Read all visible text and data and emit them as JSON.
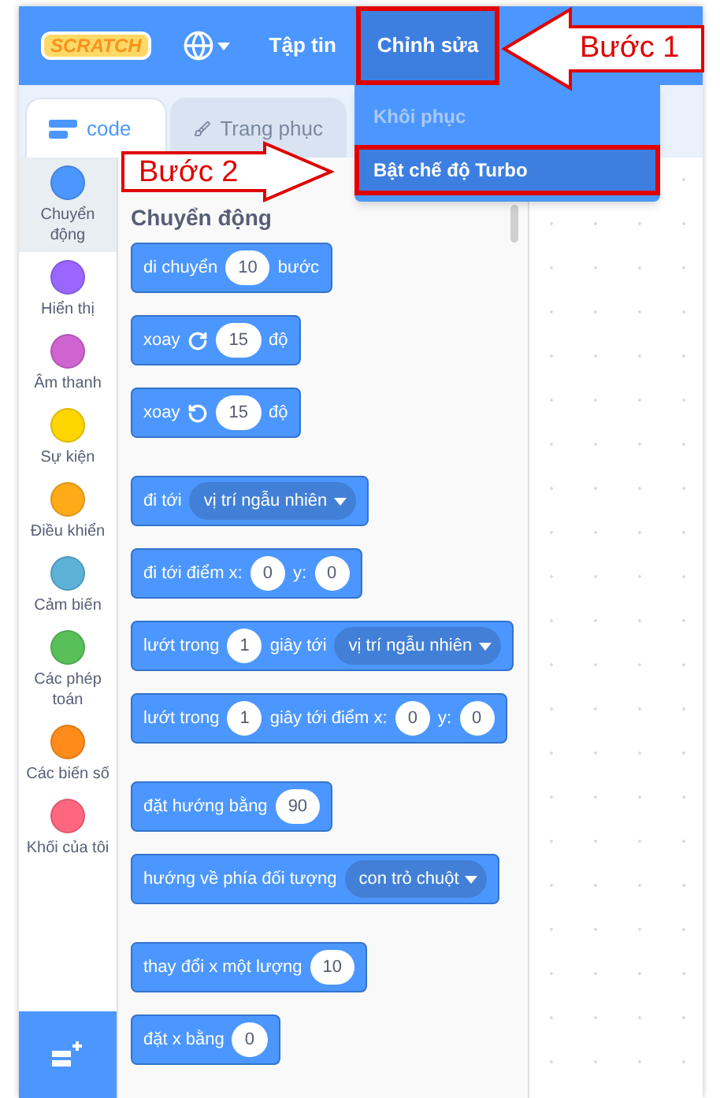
{
  "menu_bar": {
    "logo": "SCRATCH",
    "items": [
      {
        "label": "Tập tin",
        "selected": false,
        "highlighted": false
      },
      {
        "label": "Chỉnh sửa",
        "selected": true,
        "highlighted": true
      }
    ]
  },
  "edit_menu": {
    "items": [
      {
        "label": "Khôi phục",
        "disabled": true,
        "selected": false,
        "highlighted": false
      },
      {
        "label": "Bật chế độ Turbo",
        "disabled": false,
        "selected": true,
        "highlighted": true
      }
    ]
  },
  "tabs": [
    {
      "label": "code",
      "selected": true
    },
    {
      "label": "Trang phục",
      "selected": false
    }
  ],
  "categories": [
    {
      "label": "Chuyển động",
      "color": "#4c97ff",
      "selected": true
    },
    {
      "label": "Hiển thị",
      "color": "#9966ff",
      "selected": false
    },
    {
      "label": "Âm thanh",
      "color": "#cf63cf",
      "selected": false
    },
    {
      "label": "Sự kiện",
      "color": "#ffd500",
      "selected": false
    },
    {
      "label": "Điều khiển",
      "color": "#ffab19",
      "selected": false
    },
    {
      "label": "Cảm biến",
      "color": "#5cb1d6",
      "selected": false
    },
    {
      "label": "Các phép toán",
      "color": "#59c059",
      "selected": false
    },
    {
      "label": "Các biến số",
      "color": "#ff8c1a",
      "selected": false
    },
    {
      "label": "Khối của tôi",
      "color": "#ff6680",
      "selected": false
    }
  ],
  "palette": {
    "heading": "Chuyển động",
    "groups": [
      {
        "blocks": [
          [
            {
              "kind": "text",
              "text": "di chuyển"
            },
            {
              "kind": "number",
              "text": "10"
            },
            {
              "kind": "text",
              "text": "bước"
            }
          ],
          [
            {
              "kind": "text",
              "text": "xoay"
            },
            {
              "kind": "turn-right"
            },
            {
              "kind": "number",
              "text": "15"
            },
            {
              "kind": "text",
              "text": "độ"
            }
          ],
          [
            {
              "kind": "text",
              "text": "xoay"
            },
            {
              "kind": "turn-left"
            },
            {
              "kind": "number",
              "text": "15"
            },
            {
              "kind": "text",
              "text": "độ"
            }
          ]
        ]
      },
      {
        "blocks": [
          [
            {
              "kind": "text",
              "text": "đi tới"
            },
            {
              "kind": "dropdown",
              "text": "vị trí ngẫu nhiên"
            }
          ],
          [
            {
              "kind": "text",
              "text": "đi tới điểm x:"
            },
            {
              "kind": "number",
              "text": "0"
            },
            {
              "kind": "text",
              "text": "y:"
            },
            {
              "kind": "number",
              "text": "0"
            }
          ],
          [
            {
              "kind": "text",
              "text": "lướt trong"
            },
            {
              "kind": "number",
              "text": "1"
            },
            {
              "kind": "text",
              "text": "giây tới"
            },
            {
              "kind": "dropdown",
              "text": "vị trí ngẫu nhiên"
            }
          ],
          [
            {
              "kind": "text",
              "text": "lướt trong"
            },
            {
              "kind": "number",
              "text": "1"
            },
            {
              "kind": "text",
              "text": "giây tới điểm x:"
            },
            {
              "kind": "number",
              "text": "0"
            },
            {
              "kind": "text",
              "text": "y:"
            },
            {
              "kind": "number",
              "text": "0"
            }
          ]
        ]
      },
      {
        "blocks": [
          [
            {
              "kind": "text",
              "text": "đặt hướng bằng"
            },
            {
              "kind": "number",
              "text": "90"
            }
          ],
          [
            {
              "kind": "text",
              "text": "hướng về phía đối tượng"
            },
            {
              "kind": "dropdown",
              "text": "con trỏ chuột"
            }
          ]
        ]
      },
      {
        "blocks": [
          [
            {
              "kind": "text",
              "text": "thay đổi x một lượng"
            },
            {
              "kind": "number",
              "text": "10"
            }
          ],
          [
            {
              "kind": "text",
              "text": "đặt x bằng"
            },
            {
              "kind": "number",
              "text": "0"
            }
          ]
        ]
      }
    ]
  },
  "annotations": [
    {
      "kind": "left",
      "label": "Bước 1"
    },
    {
      "kind": "right",
      "label": "Bước 2"
    }
  ]
}
